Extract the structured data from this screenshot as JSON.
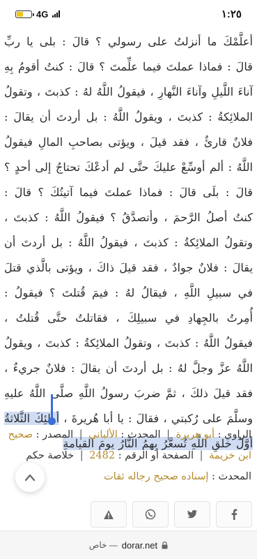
{
  "status_bar": {
    "time": "١:٢٥",
    "network": "4G"
  },
  "hadith": {
    "text_before": "أعلَّمْكَ ما أنزلتُ على رسولي ؟ قالَ : بلى يا ربِّ قالَ : فماذا عملتَ فيما علِّمتَ ؟ قالَ : كنتُ أقومُ بِهِ آناءَ اللَّيلِ وآناءَ النَّهارِ ، فيقولُ اللَّهُ لهُ : كذبتَ ، وتقولُ الملائِكةُ : كذبتَ ، ويقولُ اللَّهُ : بل أردتَ أن يقالَ : فلانٌ قارئٌ ، فقد قيلَ ، ويؤتى بصاحبِ المالِ فيقولُ اللَّهُ : ألم أوسِّعْ عليكَ حتَّى لم أدعْكَ تحتاجُ إلى أحدٍ ؟ قالَ : بلَى قالَ : فماذا عملتَ فيما آتيتُكَ ؟ قالَ : كنتُ أصلُ الرَّحمَ ، وأتصدَّقُ ؟ فيقولُ اللَّهُ : كذبتَ ، وتقولُ الملائِكةُ : كذبتَ ، فيقولُ اللَّهُ : بل أردتَ أن يقالَ : فلانٌ جوادٌ ، فقد قيلَ ذاكَ ، ويؤتى بالَّذي قتلَ في سبيلِ اللَّهِ ، فيقالُ لهُ : فيمَ قُتلتَ ؟ فيقولُ : أُمِرتُ بالجِهادِ في سبيلِكَ ، فقاتلتُ حتَّى قُتلتُ ، فيقولُ اللَّهُ : كذبتَ ، وتقولُ الملائِكةُ : كذبتَ ، ويقولُ اللَّهُ عزَّ وجلَّ لهُ : بل أردتَ أن يقالَ : فلانٌ جريءٌ ، فقد قيلَ ذلكَ ، ثمَّ ضربَ رسولُ اللَّهِ صلَّى اللَّهُ عليهِ وسلَّمَ على رُكبتي ، فقالَ : يا أبا هُريرةَ ، ",
    "text_highlighted": "أولئِكَ الثَّلاثةُ أوَّلُ خلقِ اللَّهِ تُسعَّرُ بِهمُ النَّارُ يومَ القيامةِ"
  },
  "info": {
    "narrator_label": "الراوي :",
    "narrator": "أبو هريرة",
    "muhaddith_label": "المحدث :",
    "muhaddith": "الألباني",
    "source_label": "المصدر :",
    "source": "صحيح",
    "source2": "ابن خزيمة",
    "page_label": "الصفحة أو الرقم :",
    "page": "2482",
    "ruling_label": "خلاصة حكم",
    "ruling_suffix": "المحدث :",
    "ruling": "إسناده صحيح رجاله ثقات"
  },
  "share": {
    "icons": [
      "report-icon",
      "whatsapp-icon",
      "twitter-icon",
      "facebook-icon"
    ]
  },
  "address_bar": {
    "mode": "خاص —",
    "domain": "dorar.net"
  },
  "colors": {
    "gold": "#b58a2c",
    "highlight": "#cfdcf3",
    "selection_handle": "#3b6fd6"
  }
}
